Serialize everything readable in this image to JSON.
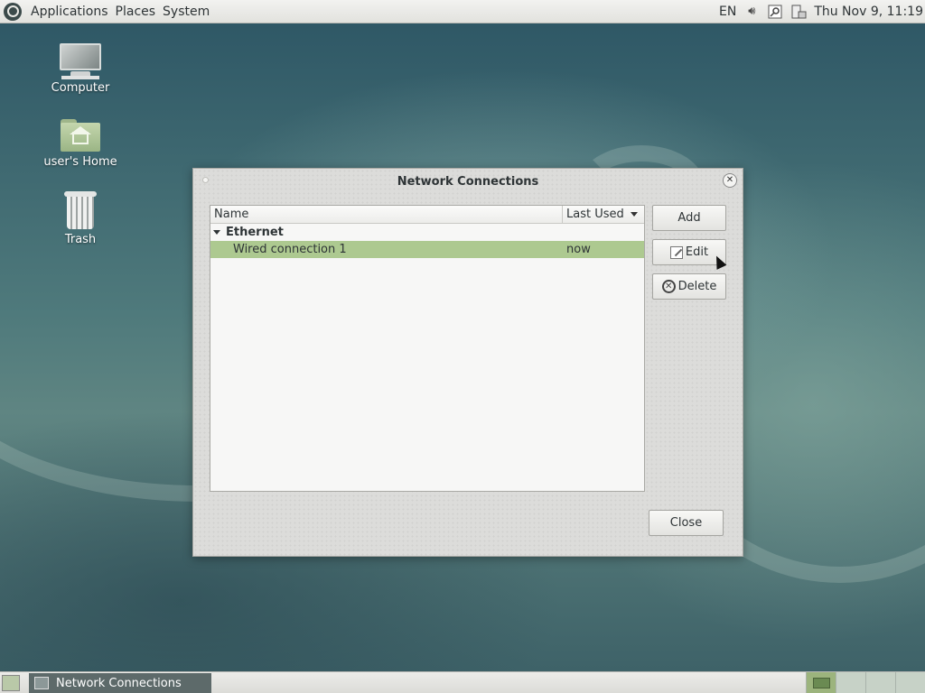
{
  "top_panel": {
    "menus": [
      "Applications",
      "Places",
      "System"
    ],
    "keyboard_layout": "EN",
    "clock": "Thu Nov  9, 11:19",
    "tray_icons": [
      "volume-icon",
      "network-manager-icon",
      "power-icon"
    ]
  },
  "desktop": {
    "icons": [
      {
        "label": "Computer",
        "icon": "computer-icon"
      },
      {
        "label": "user's Home",
        "icon": "home-folder-icon"
      },
      {
        "label": "Trash",
        "icon": "trash-icon"
      }
    ]
  },
  "dialog": {
    "title": "Network Connections",
    "columns": {
      "name": "Name",
      "last_used": "Last Used"
    },
    "groups": [
      {
        "name": "Ethernet",
        "connections": [
          {
            "name": "Wired connection 1",
            "last_used": "now",
            "selected": true
          }
        ]
      }
    ],
    "buttons": {
      "add": "Add",
      "edit": "Edit",
      "delete": "Delete",
      "close": "Close"
    },
    "selection_color": "#adc990"
  },
  "taskbar": {
    "tasks": [
      {
        "label": "Network Connections",
        "active": true
      }
    ],
    "workspaces": 4
  }
}
